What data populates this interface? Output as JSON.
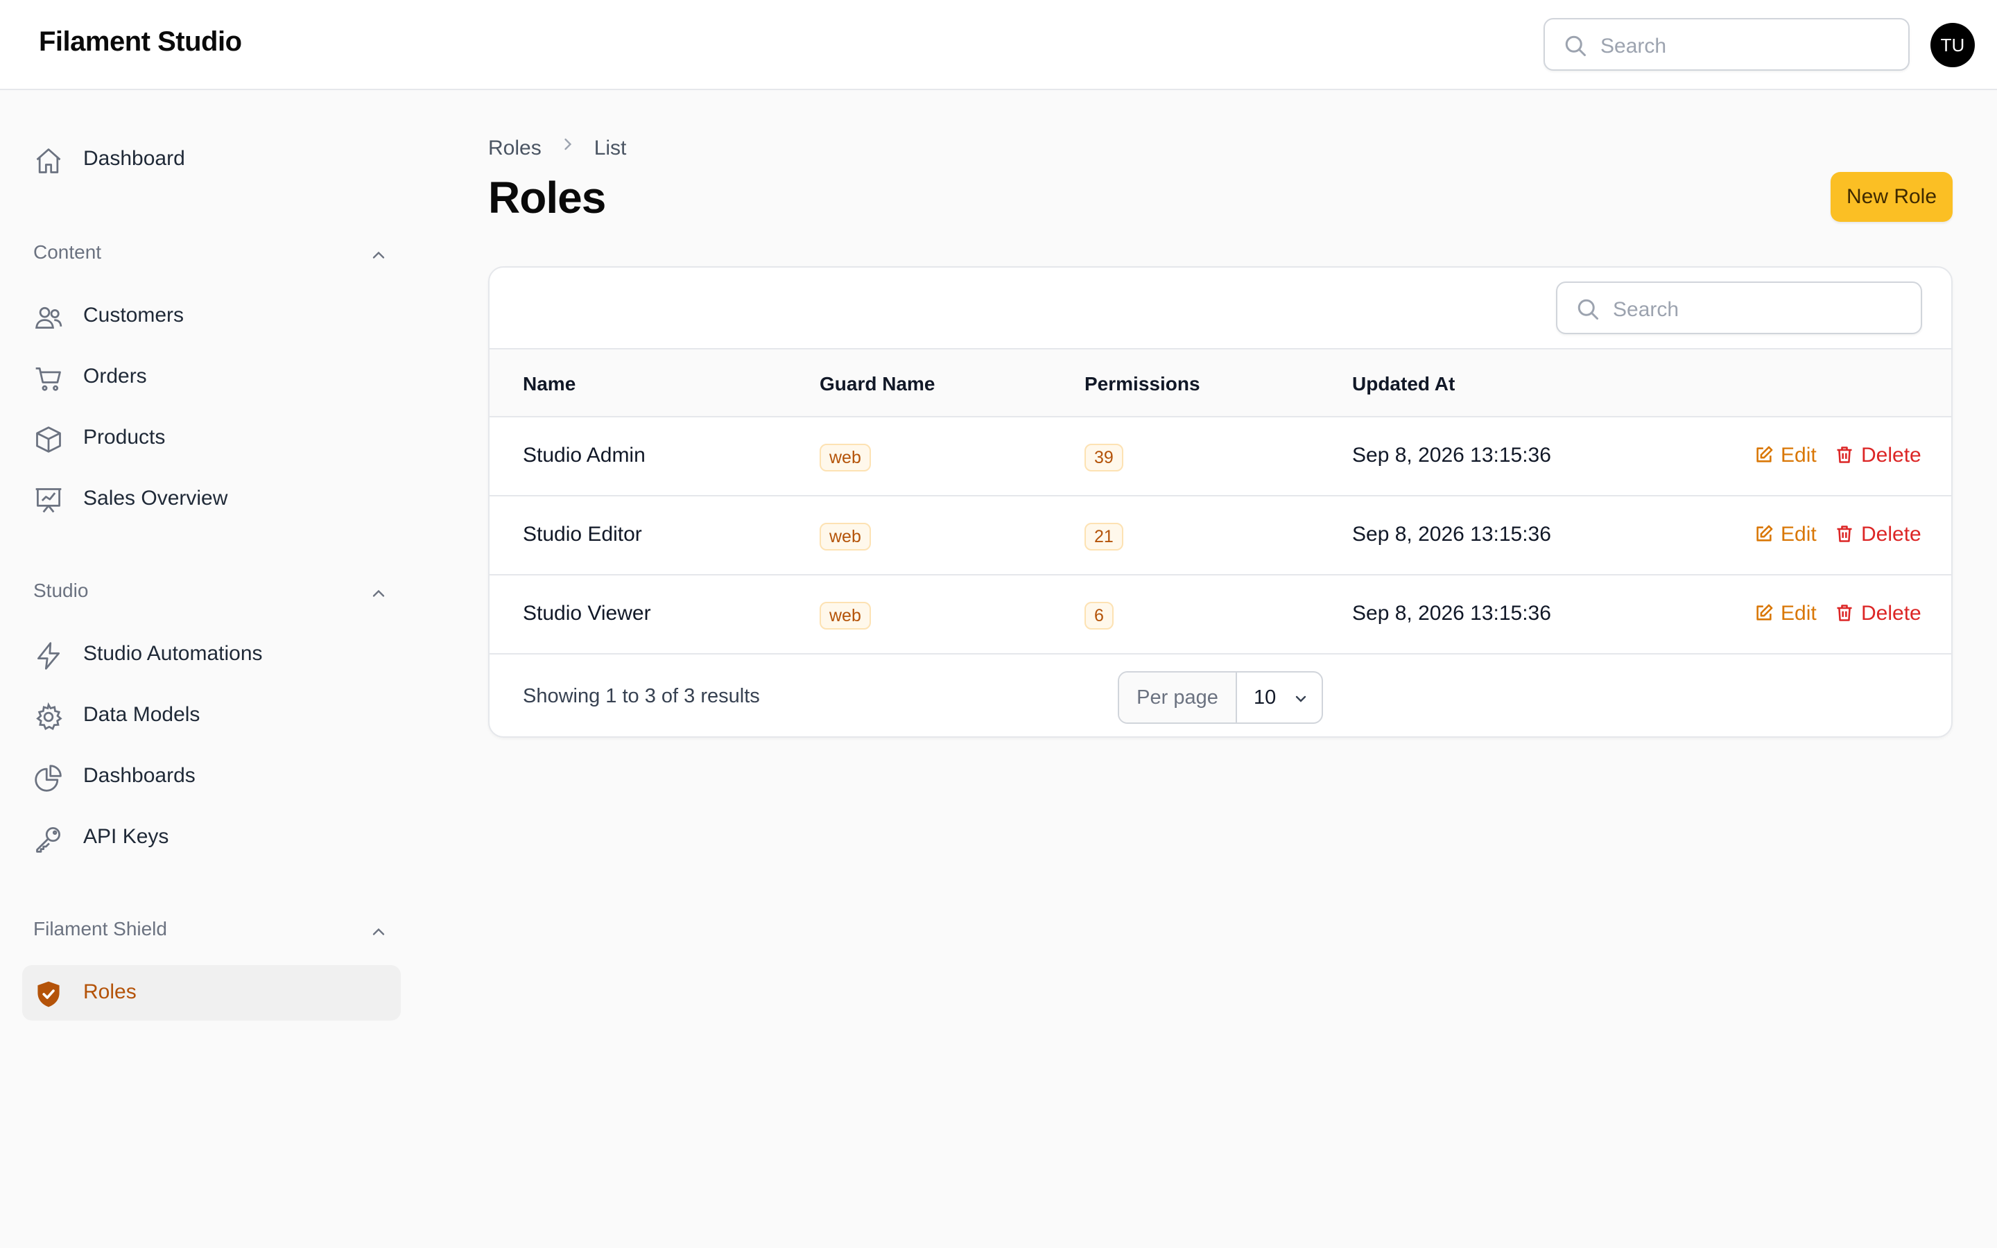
{
  "app": {
    "brand": "Filament Studio",
    "search_placeholder": "Search",
    "user_initials": "TU"
  },
  "sidebar": {
    "dashboard": {
      "label": "Dashboard",
      "icon": "home-icon"
    },
    "groups": [
      {
        "label": "Content",
        "items": [
          {
            "label": "Customers",
            "icon": "users-icon"
          },
          {
            "label": "Orders",
            "icon": "cart-icon"
          },
          {
            "label": "Products",
            "icon": "cube-icon"
          },
          {
            "label": "Sales Overview",
            "icon": "presentation-chart-icon"
          }
        ]
      },
      {
        "label": "Studio",
        "items": [
          {
            "label": "Studio Automations",
            "icon": "bolt-icon"
          },
          {
            "label": "Data Models",
            "icon": "cog-icon"
          },
          {
            "label": "Dashboards",
            "icon": "pie-chart-icon"
          },
          {
            "label": "API Keys",
            "icon": "key-icon"
          }
        ]
      },
      {
        "label": "Filament Shield",
        "items": [
          {
            "label": "Roles",
            "icon": "shield-check-icon",
            "active": true
          }
        ]
      }
    ]
  },
  "page": {
    "breadcrumb": [
      "Roles",
      "List"
    ],
    "title": "Roles",
    "new_button": "New Role"
  },
  "table": {
    "search_placeholder": "Search",
    "columns": [
      "Name",
      "Guard Name",
      "Permissions",
      "Updated At"
    ],
    "rows": [
      {
        "name": "Studio Admin",
        "guard": "web",
        "permissions": "39",
        "updated_at": "Sep 8, 2026 13:15:36"
      },
      {
        "name": "Studio Editor",
        "guard": "web",
        "permissions": "21",
        "updated_at": "Sep 8, 2026 13:15:36"
      },
      {
        "name": "Studio Viewer",
        "guard": "web",
        "permissions": "6",
        "updated_at": "Sep 8, 2026 13:15:36"
      }
    ],
    "actions": {
      "edit": "Edit",
      "delete": "Delete"
    },
    "summary": "Showing 1 to 3 of 3 results",
    "per_page_label": "Per page",
    "per_page_value": "10"
  },
  "colors": {
    "accent": "#fbbf24",
    "active_text": "#b45309",
    "edit": "#d97706",
    "delete": "#dc2626"
  }
}
